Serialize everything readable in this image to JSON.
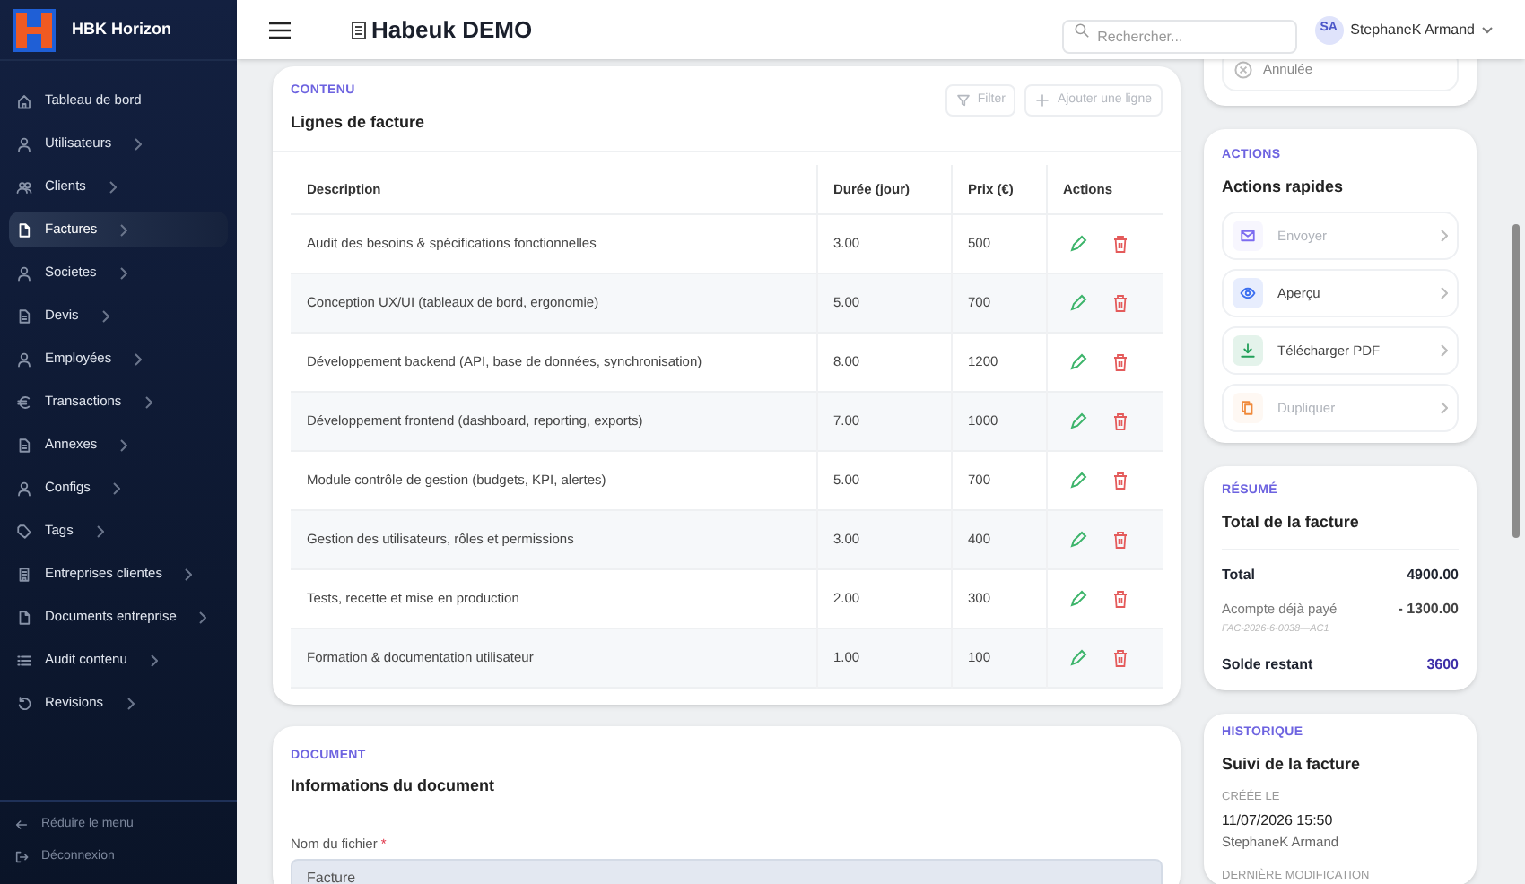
{
  "sidebar": {
    "brand": "HBK Horizon",
    "items": [
      {
        "label": "Tableau de bord",
        "has_children": false,
        "selected": false
      },
      {
        "label": "Utilisateurs",
        "has_children": true,
        "selected": false
      },
      {
        "label": "Clients",
        "has_children": true,
        "selected": false
      },
      {
        "label": "Factures",
        "has_children": true,
        "selected": true
      },
      {
        "label": "Societes",
        "has_children": true,
        "selected": false
      },
      {
        "label": "Devis",
        "has_children": true,
        "selected": false
      },
      {
        "label": "Employées",
        "has_children": true,
        "selected": false
      },
      {
        "label": "Transactions",
        "has_children": true,
        "selected": false
      },
      {
        "label": "Annexes",
        "has_children": true,
        "selected": false
      },
      {
        "label": "Configs",
        "has_children": true,
        "selected": false
      },
      {
        "label": "Tags",
        "has_children": true,
        "selected": false
      },
      {
        "label": "Entreprises clientes",
        "has_children": true,
        "selected": false
      },
      {
        "label": "Documents entreprise",
        "has_children": true,
        "selected": false
      },
      {
        "label": "Audit contenu",
        "has_children": true,
        "selected": false
      },
      {
        "label": "Revisions",
        "has_children": true,
        "selected": false
      }
    ],
    "footer": [
      {
        "label": "Réduire le menu"
      },
      {
        "label": "Déconnexion"
      }
    ]
  },
  "header": {
    "title": "Habeuk DEMO",
    "search": {
      "placeholder": "Rechercher..."
    },
    "user": {
      "initials": "SA",
      "name": "StephaneK Armand"
    }
  },
  "lines_card": {
    "eyebrow": "CONTENU",
    "title": "Lignes de facture",
    "buttons": [
      {
        "label": "Filter",
        "disabled": true
      },
      {
        "label": "Ajouter une ligne",
        "disabled": true
      }
    ],
    "table": {
      "columns": [
        "Description",
        "Durée (jour)",
        "Prix (€)",
        "Actions"
      ],
      "rows": [
        [
          "Audit des besoins & spécifications fonctionnelles",
          "3.00",
          "500"
        ],
        [
          "Conception UX/UI (tableaux de bord, ergonomie)",
          "5.00",
          "700"
        ],
        [
          "Développement backend (API, base de données, synchronisation)",
          "8.00",
          "1200"
        ],
        [
          "Développement frontend (dashboard, reporting, exports)",
          "7.00",
          "1000"
        ],
        [
          "Module contrôle de gestion (budgets, KPI, alertes)",
          "5.00",
          "700"
        ],
        [
          "Gestion des utilisateurs, rôles et permissions",
          "3.00",
          "400"
        ],
        [
          "Tests, recette et mise en production",
          "2.00",
          "300"
        ],
        [
          "Formation & documentation utilisateur",
          "1.00",
          "100"
        ]
      ]
    }
  },
  "document_card": {
    "eyebrow": "DOCUMENT",
    "title": "Informations du document",
    "field": {
      "label": "Nom du fichier",
      "required_mark": "*",
      "value": "Facture"
    }
  },
  "status_card": {
    "option": "Annulée"
  },
  "actions_card": {
    "eyebrow": "ACTIONS",
    "title": "Actions rapides",
    "items": [
      {
        "label": "Envoyer",
        "color": "#7c6cf0",
        "disabled": true
      },
      {
        "label": "Aperçu",
        "color": "#3b6ff0",
        "disabled": false
      },
      {
        "label": "Télécharger PDF",
        "color": "#22a05a",
        "disabled": false
      },
      {
        "label": "Dupliquer",
        "color": "#f08a3c",
        "disabled": true
      }
    ]
  },
  "summary_card": {
    "eyebrow": "RÉSUMÉ",
    "title": "Total de la facture",
    "total_label": "Total",
    "total": "4900.00",
    "deposit_label": "Acompte déjà payé",
    "deposit": "- 1300.00",
    "deposit_ref": "FAC-2026-6-0038—AC1",
    "balance_label": "Solde restant",
    "balance": "3600"
  },
  "history_card": {
    "eyebrow": "HISTORIQUE",
    "title": "Suivi de la facture",
    "created_label": "CRÉÉE LE",
    "created_date": "11/07/2026 15:50",
    "created_by": "StephaneK Armand",
    "modified_label": "DERNIÈRE MODIFICATION"
  }
}
